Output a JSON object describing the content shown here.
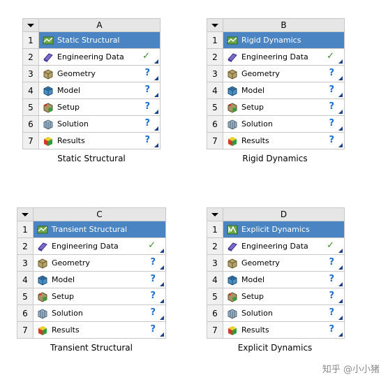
{
  "systems": [
    {
      "column": "A",
      "caption": "Static Structural",
      "cells": [
        {
          "num": "1",
          "label": "Static Structural",
          "icon": "static-structural-icon",
          "status": ""
        },
        {
          "num": "2",
          "label": "Engineering Data",
          "icon": "engineering-data-icon",
          "status": "✓"
        },
        {
          "num": "3",
          "label": "Geometry",
          "icon": "geometry-icon",
          "status": "?"
        },
        {
          "num": "4",
          "label": "Model",
          "icon": "model-icon",
          "status": "?"
        },
        {
          "num": "5",
          "label": "Setup",
          "icon": "setup-icon",
          "status": "?"
        },
        {
          "num": "6",
          "label": "Solution",
          "icon": "solution-icon",
          "status": "?"
        },
        {
          "num": "7",
          "label": "Results",
          "icon": "results-icon",
          "status": "?"
        }
      ]
    },
    {
      "column": "B",
      "caption": "Rigid Dynamics",
      "cells": [
        {
          "num": "1",
          "label": "Rigid Dynamics",
          "icon": "rigid-dynamics-icon",
          "status": ""
        },
        {
          "num": "2",
          "label": "Engineering Data",
          "icon": "engineering-data-icon",
          "status": "✓"
        },
        {
          "num": "3",
          "label": "Geometry",
          "icon": "geometry-icon",
          "status": "?"
        },
        {
          "num": "4",
          "label": "Model",
          "icon": "model-icon",
          "status": "?"
        },
        {
          "num": "5",
          "label": "Setup",
          "icon": "setup-icon",
          "status": "?"
        },
        {
          "num": "6",
          "label": "Solution",
          "icon": "solution-icon",
          "status": "?"
        },
        {
          "num": "7",
          "label": "Results",
          "icon": "results-icon",
          "status": "?"
        }
      ]
    },
    {
      "column": "C",
      "caption": "Transient Structural",
      "cells": [
        {
          "num": "1",
          "label": "Transient Structural",
          "icon": "transient-structural-icon",
          "status": ""
        },
        {
          "num": "2",
          "label": "Engineering Data",
          "icon": "engineering-data-icon",
          "status": "✓"
        },
        {
          "num": "3",
          "label": "Geometry",
          "icon": "geometry-icon",
          "status": "?"
        },
        {
          "num": "4",
          "label": "Model",
          "icon": "model-icon",
          "status": "?"
        },
        {
          "num": "5",
          "label": "Setup",
          "icon": "setup-icon",
          "status": "?"
        },
        {
          "num": "6",
          "label": "Solution",
          "icon": "solution-icon",
          "status": "?"
        },
        {
          "num": "7",
          "label": "Results",
          "icon": "results-icon",
          "status": "?"
        }
      ]
    },
    {
      "column": "D",
      "caption": "Explicit Dynamics",
      "cells": [
        {
          "num": "1",
          "label": "Explicit Dynamics",
          "icon": "explicit-dynamics-icon",
          "status": ""
        },
        {
          "num": "2",
          "label": "Engineering Data",
          "icon": "engineering-data-icon",
          "status": "✓"
        },
        {
          "num": "3",
          "label": "Geometry",
          "icon": "geometry-icon",
          "status": "?"
        },
        {
          "num": "4",
          "label": "Model",
          "icon": "model-icon",
          "status": "?"
        },
        {
          "num": "5",
          "label": "Setup",
          "icon": "setup-icon",
          "status": "?"
        },
        {
          "num": "6",
          "label": "Solution",
          "icon": "solution-icon",
          "status": "?"
        },
        {
          "num": "7",
          "label": "Results",
          "icon": "results-icon",
          "status": "?"
        }
      ]
    }
  ],
  "watermark": "知乎 @小小猪",
  "colors": {
    "title_row": "#4a84c2",
    "check": "#3b8a2a",
    "question": "#1f6fd1",
    "corner": "#1a3f8f"
  }
}
